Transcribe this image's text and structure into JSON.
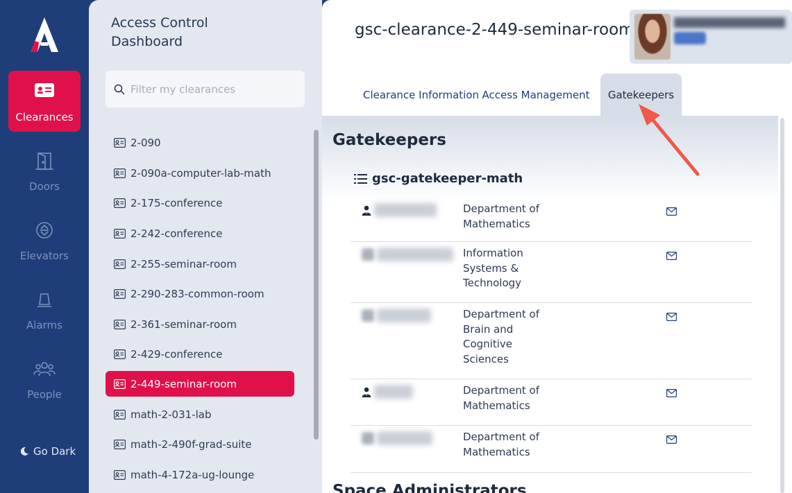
{
  "nav": {
    "logo": "A",
    "items": [
      {
        "label": "Clearances",
        "icon": "id-card-icon",
        "active": true
      },
      {
        "label": "Doors",
        "icon": "door-icon",
        "active": false
      },
      {
        "label": "Elevators",
        "icon": "elevator-icon",
        "active": false
      },
      {
        "label": "Alarms",
        "icon": "alarm-icon",
        "active": false
      },
      {
        "label": "People",
        "icon": "people-icon",
        "active": false
      }
    ],
    "go_dark": "Go Dark"
  },
  "sidebar": {
    "title": "Access Control Dashboard",
    "filter_placeholder": "Filter my clearances",
    "items": [
      {
        "label": "2-090"
      },
      {
        "label": "2-090a-computer-lab-math"
      },
      {
        "label": "2-175-conference"
      },
      {
        "label": "2-242-conference"
      },
      {
        "label": "2-255-seminar-room"
      },
      {
        "label": "2-290-283-common-room"
      },
      {
        "label": "2-361-seminar-room"
      },
      {
        "label": "2-429-conference"
      },
      {
        "label": "2-449-seminar-room",
        "active": true
      },
      {
        "label": "math-2-031-lab"
      },
      {
        "label": "math-2-490f-grad-suite"
      },
      {
        "label": "math-4-172a-ug-lounge"
      }
    ]
  },
  "main": {
    "title": "gsc-clearance-2-449-seminar-room",
    "tabs": [
      {
        "label": "Clearance Information"
      },
      {
        "label": "Access Management"
      },
      {
        "label": "Gatekeepers",
        "active": true
      }
    ],
    "section_heading": "Gatekeepers",
    "group_name": "gsc-gatekeeper-math",
    "gatekeepers": [
      {
        "department": "Department of Mathematics"
      },
      {
        "department": "Information Systems & Technology"
      },
      {
        "department": "Department of Brain and Cognitive Sciences"
      },
      {
        "department": "Department of Mathematics"
      },
      {
        "department": "Department of Mathematics"
      }
    ],
    "next_section_heading": "Space Administrators"
  },
  "colors": {
    "rail": "#1f3d78",
    "accent": "#e0114a",
    "arrow": "#f0584a"
  }
}
